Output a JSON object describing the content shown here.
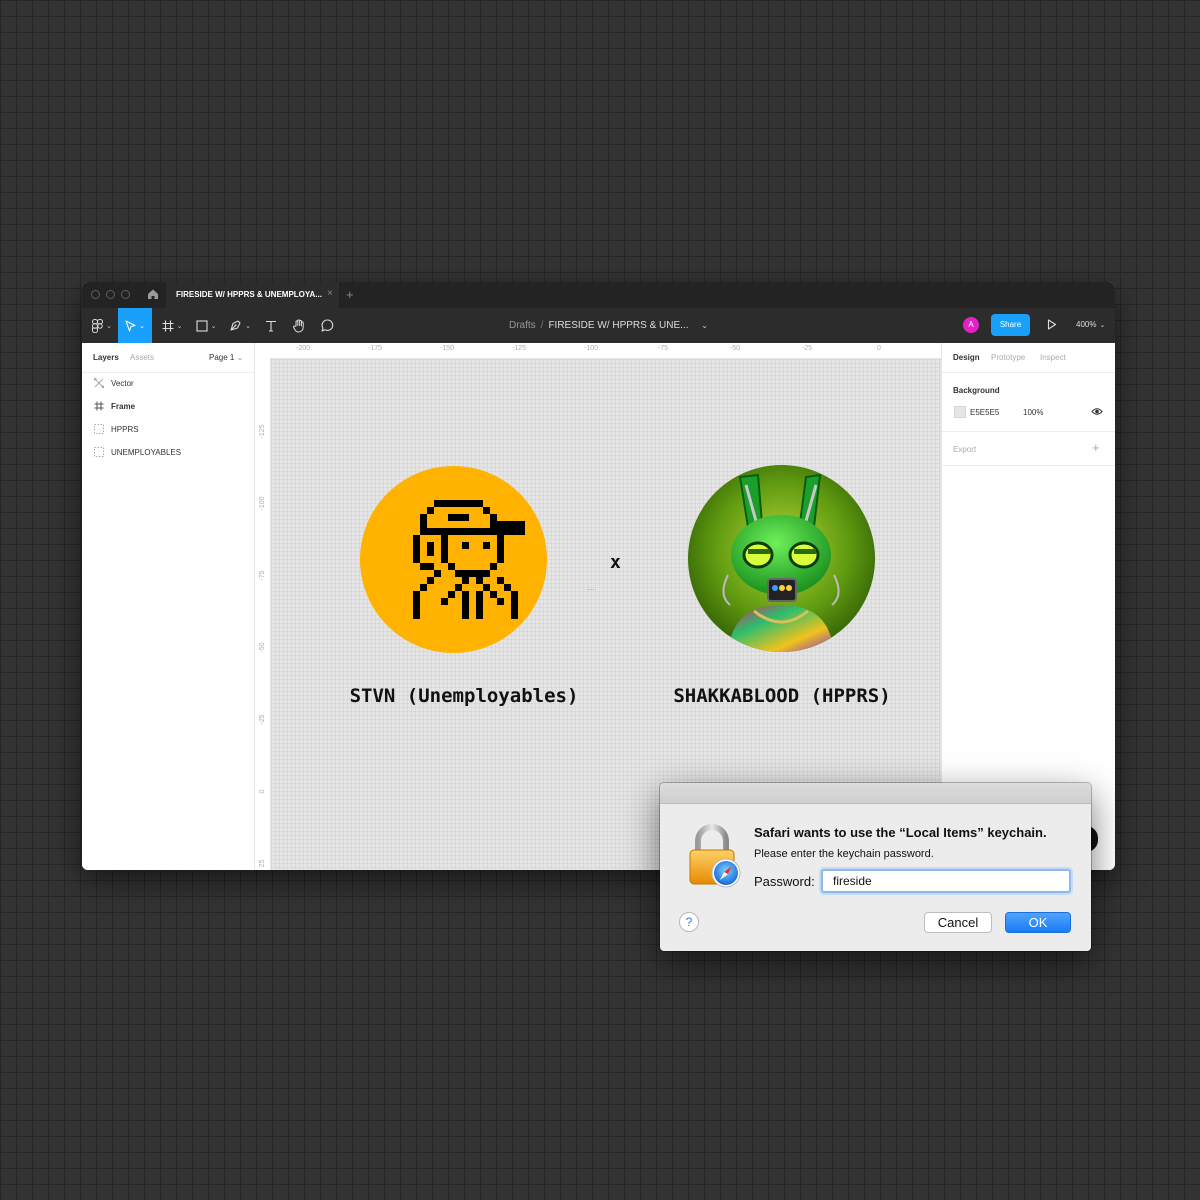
{
  "app": {
    "tab_title": "FIRESIDE W/ HPPRS & UNEMPLOYA...",
    "tab_close": "×",
    "tab_add": "+"
  },
  "toolbar": {
    "breadcrumb_root": "Drafts",
    "breadcrumb_sep": "/",
    "breadcrumb_file": "FIRESIDE W/ HPPRS & UNE...",
    "avatar_initial": "A",
    "share_label": "Share",
    "zoom_level": "400%",
    "accent_color": "#18a0fb"
  },
  "left_panel": {
    "tabs": [
      "Layers",
      "Assets"
    ],
    "page_label": "Page 1",
    "layers": [
      {
        "label": "Vector",
        "icon": "vector-icon"
      },
      {
        "label": "Frame",
        "icon": "frame-icon"
      },
      {
        "label": "HPPRS",
        "icon": "group-icon"
      },
      {
        "label": "UNEMPLOYABLES",
        "icon": "group-icon"
      }
    ]
  },
  "rulers": {
    "top": [
      "-200",
      "-175",
      "-150",
      "-125",
      "-100",
      "-75",
      "-50",
      "-25",
      "0"
    ],
    "left": [
      "-125",
      "-100",
      "-75",
      "-50",
      "-25",
      "0",
      "25"
    ]
  },
  "canvas": {
    "left_name": "STVN (Unemployables)",
    "right_name": "SHAKKABLOOD (HPPRS)",
    "separator": "x",
    "left_avatar_bg": "#FFB200"
  },
  "right_panel": {
    "tabs": [
      "Design",
      "Prototype",
      "Inspect"
    ],
    "background_title": "Background",
    "background_hex": "E5E5E5",
    "background_opacity": "100%",
    "export_title": "Export",
    "export_add": "+"
  },
  "dialog": {
    "title": "Safari wants to use the “Local Items” keychain.",
    "subtitle": "Please enter the keychain password.",
    "password_label": "Password:",
    "password_value": "fireside",
    "help_label": "?",
    "cancel_label": "Cancel",
    "ok_label": "OK"
  }
}
